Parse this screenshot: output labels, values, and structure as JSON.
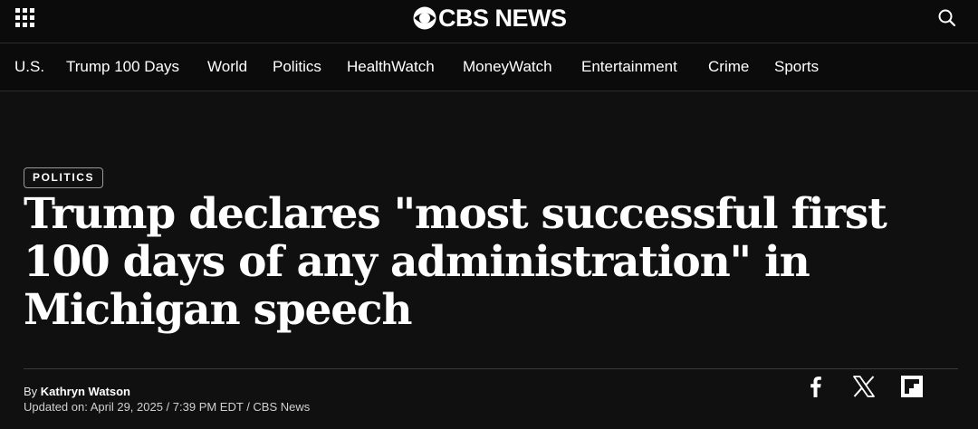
{
  "header": {
    "brand_name": "CBS NEWS",
    "menu_icon": "grid-menu-icon",
    "search_icon": "search-icon"
  },
  "nav": {
    "items": [
      {
        "label": "U.S."
      },
      {
        "label": "Trump 100 Days"
      },
      {
        "label": "World"
      },
      {
        "label": "Politics"
      },
      {
        "label": "HealthWatch"
      },
      {
        "label": "MoneyWatch"
      },
      {
        "label": "Entertainment"
      },
      {
        "label": "Crime"
      },
      {
        "label": "Sports"
      }
    ]
  },
  "article": {
    "category": "POLITICS",
    "headline": "Trump declares \"most successful first 100 days of any administration\" in Michigan speech",
    "byline_prefix": "By",
    "author": "Kathryn Watson",
    "updated": "Updated on: April 29, 2025 / 7:39 PM EDT / CBS News"
  },
  "share": {
    "icons": [
      "facebook-icon",
      "x-icon",
      "flipboard-icon"
    ]
  },
  "colors": {
    "background": "#101010",
    "text": "#ffffff"
  }
}
